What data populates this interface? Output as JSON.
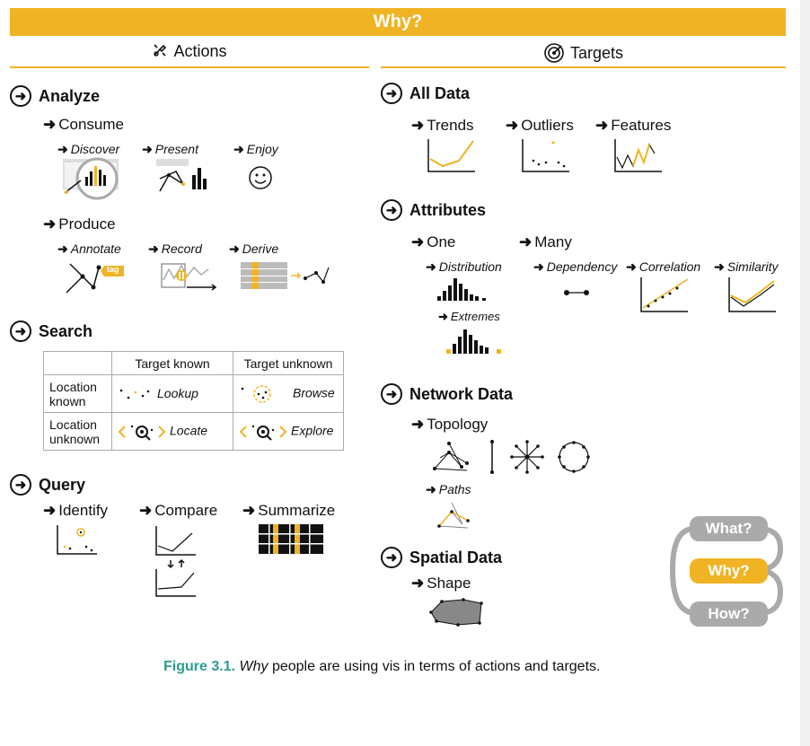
{
  "banner": "Why?",
  "columns": {
    "actions": "Actions",
    "targets": "Targets"
  },
  "actions": {
    "analyze": {
      "label": "Analyze",
      "consume": {
        "label": "Consume",
        "items": [
          "Discover",
          "Present",
          "Enjoy"
        ]
      },
      "produce": {
        "label": "Produce",
        "items": [
          "Annotate",
          "Record",
          "Derive"
        ],
        "tag": "tag"
      }
    },
    "search": {
      "label": "Search",
      "table": {
        "col_headers": [
          "Target known",
          "Target unknown"
        ],
        "rows": [
          {
            "header": "Location known",
            "cells": [
              "Lookup",
              "Browse"
            ]
          },
          {
            "header": "Location unknown",
            "cells": [
              "Locate",
              "Explore"
            ]
          }
        ]
      }
    },
    "query": {
      "label": "Query",
      "items": [
        "Identify",
        "Compare",
        "Summarize"
      ]
    }
  },
  "targets": {
    "all_data": {
      "label": "All Data",
      "items": [
        "Trends",
        "Outliers",
        "Features"
      ]
    },
    "attributes": {
      "label": "Attributes",
      "one": {
        "label": "One",
        "items": [
          "Distribution",
          "Extremes"
        ]
      },
      "many": {
        "label": "Many",
        "items": [
          "Dependency",
          "Correlation",
          "Similarity"
        ]
      }
    },
    "network": {
      "label": "Network Data",
      "topology": "Topology",
      "paths": "Paths"
    },
    "spatial": {
      "label": "Spatial Data",
      "shape": "Shape"
    }
  },
  "nav": {
    "what": "What?",
    "why": "Why?",
    "how": "How?"
  },
  "colors": {
    "accent": "#f0b323",
    "nav_gray": "#aaaaaa",
    "caption_teal": "#2a9d8f"
  },
  "caption": {
    "figure": "Figure 3.1.",
    "emph": "Why",
    "text": "people are using vis in terms of actions and targets."
  }
}
